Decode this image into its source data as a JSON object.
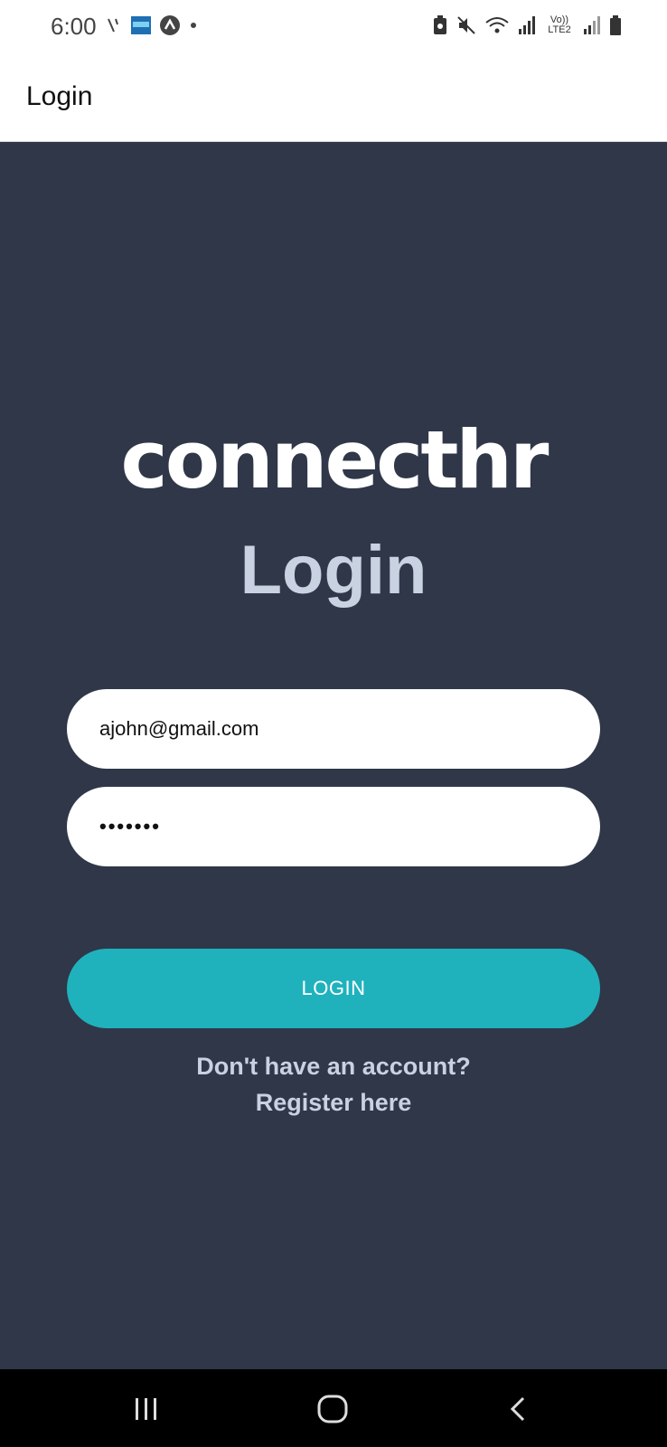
{
  "status_bar": {
    "time": "6:00",
    "network_label": "Vo)) LTE2",
    "icons": [
      "phone-signal-icon",
      "app-thumbnail-icon",
      "app-logo-icon",
      "notification-dot-icon",
      "battery-saver-icon",
      "mute-icon",
      "wifi-icon",
      "signal-icon",
      "battery-icon"
    ]
  },
  "app_bar": {
    "title": "Login"
  },
  "main": {
    "logo_text": "connecthr",
    "heading": "Login",
    "email_value": "ajohn@gmail.com",
    "password_value": "•••••••",
    "login_button": "LOGIN",
    "register_line1": "Don't have an account?",
    "register_line2": "Register here"
  },
  "colors": {
    "background": "#2f3749",
    "accent": "#1fb2bd",
    "heading": "#c9d2e0"
  },
  "nav_bar": {
    "buttons": [
      "recent-apps-icon",
      "home-icon",
      "back-icon"
    ]
  }
}
